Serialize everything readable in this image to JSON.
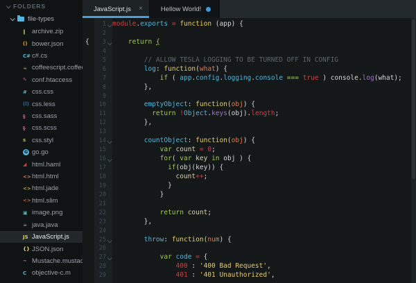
{
  "ui_colors": {
    "accent_blue": "#4c9fd6",
    "sidebar_bg": "#101314",
    "editor_bg": "#151819",
    "tabbar_bg": "#24292d",
    "selection_bg": "#222729"
  },
  "sidebar": {
    "header": "FOLDERS",
    "root_folder": "file-types",
    "files": [
      {
        "name": "archive.zip",
        "icon": "zip-icon",
        "glyph": "‖",
        "color": "#9fca56"
      },
      {
        "name": "bower.json",
        "icon": "bower-icon",
        "glyph": "()",
        "color": "#dba44d"
      },
      {
        "name": "c#.cs",
        "icon": "csharp-icon",
        "glyph": "C#",
        "color": "#55b5db"
      },
      {
        "name": "coffeescript.coffee",
        "icon": "coffee-icon",
        "glyph": "☕",
        "color": "#bd9a7a"
      },
      {
        "name": "conf.htaccess",
        "icon": "htaccess-icon",
        "glyph": "✎",
        "color": "#d44a8c"
      },
      {
        "name": "css.css",
        "icon": "css-icon",
        "glyph": "#",
        "color": "#55b5db"
      },
      {
        "name": "css.less",
        "icon": "less-icon",
        "glyph": "(l)",
        "color": "#35679a"
      },
      {
        "name": "css.sass",
        "icon": "sass-icon",
        "glyph": "§",
        "color": "#d4518e"
      },
      {
        "name": "css.scss",
        "icon": "scss-icon",
        "glyph": "§",
        "color": "#d4518e"
      },
      {
        "name": "css.styl",
        "icon": "stylus-icon",
        "glyph": "s",
        "color": "#9fca56"
      },
      {
        "name": "go.go",
        "icon": "go-icon",
        "glyph": "G",
        "color": "#101314",
        "round_bg": "#55b5db"
      },
      {
        "name": "html.haml",
        "icon": "haml-icon",
        "glyph": "◢",
        "color": "#cd3f45"
      },
      {
        "name": "html.html",
        "icon": "html-icon",
        "glyph": "<>",
        "color": "#db7b55"
      },
      {
        "name": "html.jade",
        "icon": "jade-icon",
        "glyph": "<>",
        "color": "#b9a34f"
      },
      {
        "name": "html.slim",
        "icon": "slim-icon",
        "glyph": "<>",
        "color": "#d05a3a"
      },
      {
        "name": "image.png",
        "icon": "image-icon",
        "glyph": "▣",
        "color": "#52b7bb"
      },
      {
        "name": "java.java",
        "icon": "java-icon",
        "glyph": "☕",
        "color": "#a0aabb"
      },
      {
        "name": "JavaScript.js",
        "icon": "javascript-icon",
        "glyph": "JS",
        "color": "#e6cd69",
        "selected": true
      },
      {
        "name": "JSON.json",
        "icon": "json-icon",
        "glyph": "{}",
        "color": "#e6cd69"
      },
      {
        "name": "Mustache.mustache",
        "icon": "mustache-icon",
        "glyph": "~",
        "color": "#db7b55"
      },
      {
        "name": "objective-c.m",
        "icon": "objective-c-icon",
        "glyph": "C",
        "color": "#55b5db"
      }
    ]
  },
  "tabs": [
    {
      "title": "JavaScript.js",
      "active": true,
      "close_label": "×"
    },
    {
      "title": "Hellow World!",
      "active": false,
      "modified": true
    }
  ],
  "editor": {
    "palette": {
      "red": "#cd3f45",
      "blue": "#55b5db",
      "green": "#9fca56",
      "yellow": "#e6cd69",
      "purple": "#a074c4",
      "orange": "#db7b55",
      "cream": "#d8d2b0",
      "comment": "#5b666c",
      "fg": "#d6d6d6"
    },
    "lines": [
      {
        "n": 1,
        "fold": true,
        "segs": [
          [
            "module",
            "red"
          ],
          [
            ".",
            "fg"
          ],
          [
            "exports",
            "blue"
          ],
          [
            " ",
            "fg"
          ],
          [
            "=",
            "red"
          ],
          [
            " ",
            "fg"
          ],
          [
            "function",
            "yellow"
          ],
          [
            " (app) {",
            "fg"
          ]
        ]
      },
      {
        "n": 2,
        "segs": []
      },
      {
        "n": 3,
        "fold": true,
        "gutter_brace": "{",
        "segs": [
          [
            "    ",
            "fg"
          ],
          [
            "return",
            "green"
          ],
          [
            " ",
            "fg"
          ],
          [
            "{",
            "green",
            "u"
          ]
        ]
      },
      {
        "n": 4,
        "segs": []
      },
      {
        "n": 5,
        "segs": [
          [
            "        ",
            "fg"
          ],
          [
            "// ALLOW TESLA LOGGING TO BE TURNED OFF IN CONFIG",
            "comment"
          ]
        ]
      },
      {
        "n": 6,
        "segs": [
          [
            "        ",
            "fg"
          ],
          [
            "log",
            "blue"
          ],
          [
            ": ",
            "fg"
          ],
          [
            "function",
            "yellow"
          ],
          [
            "(",
            "fg"
          ],
          [
            "what",
            "orange"
          ],
          [
            ") {",
            "fg"
          ]
        ]
      },
      {
        "n": 7,
        "segs": [
          [
            "            ",
            "fg"
          ],
          [
            "if",
            "green"
          ],
          [
            " ( ",
            "fg"
          ],
          [
            "app",
            "blue"
          ],
          [
            ".",
            "fg"
          ],
          [
            "config",
            "blue"
          ],
          [
            ".",
            "fg"
          ],
          [
            "logging",
            "blue"
          ],
          [
            ".",
            "fg"
          ],
          [
            "console",
            "blue"
          ],
          [
            " ",
            "fg"
          ],
          [
            "===",
            "green"
          ],
          [
            " ",
            "fg"
          ],
          [
            "true",
            "red"
          ],
          [
            " ) ",
            "fg"
          ],
          [
            "console",
            "fg"
          ],
          [
            ".",
            "fg"
          ],
          [
            "log",
            "purple"
          ],
          [
            "(what);",
            "fg"
          ]
        ]
      },
      {
        "n": 8,
        "segs": [
          [
            "        },",
            "fg"
          ]
        ]
      },
      {
        "n": 9,
        "segs": []
      },
      {
        "n": 10,
        "segs": [
          [
            "        ",
            "fg"
          ],
          [
            "emptyObject",
            "blue"
          ],
          [
            ": ",
            "fg"
          ],
          [
            "function",
            "yellow"
          ],
          [
            "(",
            "fg"
          ],
          [
            "obj",
            "orange"
          ],
          [
            ") {",
            "fg"
          ]
        ]
      },
      {
        "n": 11,
        "segs": [
          [
            "          ",
            "fg"
          ],
          [
            "return",
            "green"
          ],
          [
            " ",
            "fg"
          ],
          [
            "!",
            "red"
          ],
          [
            "Object",
            "blue"
          ],
          [
            ".",
            "fg"
          ],
          [
            "keys",
            "purple"
          ],
          [
            "(obj).",
            "fg"
          ],
          [
            "length",
            "red"
          ],
          [
            ";",
            "fg"
          ]
        ]
      },
      {
        "n": 12,
        "segs": [
          [
            "        },",
            "fg"
          ]
        ]
      },
      {
        "n": 13,
        "segs": []
      },
      {
        "n": 14,
        "fold": true,
        "segs": [
          [
            "        ",
            "fg"
          ],
          [
            "countObject",
            "blue"
          ],
          [
            ": ",
            "fg"
          ],
          [
            "function",
            "yellow"
          ],
          [
            "(",
            "fg"
          ],
          [
            "obj",
            "orange"
          ],
          [
            ") {",
            "fg"
          ]
        ]
      },
      {
        "n": 15,
        "segs": [
          [
            "            ",
            "fg"
          ],
          [
            "var",
            "green"
          ],
          [
            " ",
            "fg"
          ],
          [
            "count",
            "cream"
          ],
          [
            " ",
            "fg"
          ],
          [
            "=",
            "red"
          ],
          [
            " ",
            "fg"
          ],
          [
            "0",
            "red"
          ],
          [
            ";",
            "fg"
          ]
        ]
      },
      {
        "n": 16,
        "fold": true,
        "segs": [
          [
            "            ",
            "fg"
          ],
          [
            "for",
            "green"
          ],
          [
            "( ",
            "fg"
          ],
          [
            "var",
            "green"
          ],
          [
            " ",
            "fg"
          ],
          [
            "key",
            "cream"
          ],
          [
            " ",
            "fg"
          ],
          [
            "in",
            "green"
          ],
          [
            " obj ) {",
            "fg"
          ]
        ]
      },
      {
        "n": 17,
        "segs": [
          [
            "              ",
            "fg"
          ],
          [
            "if",
            "green"
          ],
          [
            "(obj(key)) {",
            "fg"
          ]
        ]
      },
      {
        "n": 18,
        "segs": [
          [
            "                ",
            "fg"
          ],
          [
            "count",
            "cream"
          ],
          [
            "++",
            "red"
          ],
          [
            ";",
            "fg"
          ]
        ]
      },
      {
        "n": 19,
        "segs": [
          [
            "              }",
            "fg"
          ]
        ]
      },
      {
        "n": 20,
        "segs": [
          [
            "            }",
            "fg"
          ]
        ]
      },
      {
        "n": 21,
        "segs": []
      },
      {
        "n": 22,
        "segs": [
          [
            "            ",
            "fg"
          ],
          [
            "return",
            "green"
          ],
          [
            " ",
            "fg"
          ],
          [
            "count",
            "cream"
          ],
          [
            ";",
            "fg"
          ]
        ]
      },
      {
        "n": 23,
        "segs": [
          [
            "        },",
            "fg"
          ]
        ]
      },
      {
        "n": 24,
        "segs": []
      },
      {
        "n": 25,
        "fold": true,
        "segs": [
          [
            "        ",
            "fg"
          ],
          [
            "throw",
            "blue"
          ],
          [
            ": ",
            "fg"
          ],
          [
            "function",
            "yellow"
          ],
          [
            "(",
            "fg"
          ],
          [
            "num",
            "orange"
          ],
          [
            ") {",
            "fg"
          ]
        ]
      },
      {
        "n": 26,
        "segs": []
      },
      {
        "n": 27,
        "fold": true,
        "segs": [
          [
            "            ",
            "fg"
          ],
          [
            "var",
            "green"
          ],
          [
            " ",
            "fg"
          ],
          [
            "code",
            "blue"
          ],
          [
            " ",
            "fg"
          ],
          [
            "=",
            "red"
          ],
          [
            " {",
            "fg"
          ]
        ]
      },
      {
        "n": 28,
        "segs": [
          [
            "                ",
            "fg"
          ],
          [
            "400",
            "red"
          ],
          [
            " : ",
            "fg"
          ],
          [
            "'400 Bad Request'",
            "yellow"
          ],
          [
            ",",
            "fg"
          ]
        ]
      },
      {
        "n": 29,
        "segs": [
          [
            "                ",
            "fg"
          ],
          [
            "401",
            "red"
          ],
          [
            " : ",
            "fg"
          ],
          [
            "'401 Unauthorized'",
            "yellow"
          ],
          [
            ",",
            "fg"
          ]
        ]
      }
    ]
  }
}
